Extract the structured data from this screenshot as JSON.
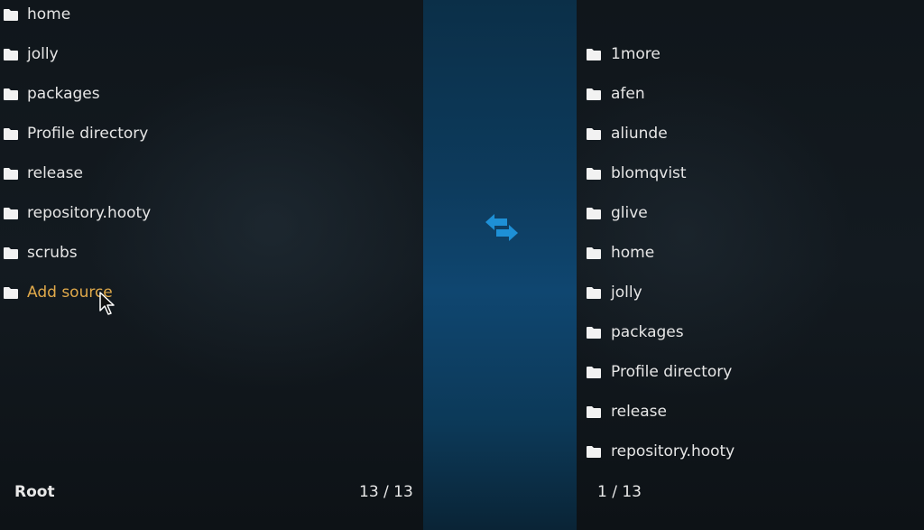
{
  "left_pane": {
    "items": [
      {
        "label": "home",
        "icon": "folder-icon"
      },
      {
        "label": "jolly",
        "icon": "folder-icon"
      },
      {
        "label": "packages",
        "icon": "folder-icon"
      },
      {
        "label": "Profile directory",
        "icon": "folder-icon"
      },
      {
        "label": "release",
        "icon": "folder-icon"
      },
      {
        "label": "repository.hooty",
        "icon": "folder-icon"
      },
      {
        "label": "scrubs",
        "icon": "folder-icon"
      },
      {
        "label": "Add source",
        "icon": "folder-icon",
        "highlight": true
      }
    ],
    "footer_label": "Root",
    "count": "13 / 13"
  },
  "center": {
    "icon": "swap-arrows-icon"
  },
  "right_pane": {
    "items": [
      {
        "label": "1more",
        "icon": "folder-icon"
      },
      {
        "label": "afen",
        "icon": "folder-icon"
      },
      {
        "label": "aliunde",
        "icon": "folder-icon"
      },
      {
        "label": "blomqvist",
        "icon": "folder-icon"
      },
      {
        "label": "glive",
        "icon": "folder-icon"
      },
      {
        "label": "home",
        "icon": "folder-icon"
      },
      {
        "label": "jolly",
        "icon": "folder-icon"
      },
      {
        "label": "packages",
        "icon": "folder-icon"
      },
      {
        "label": "Profile directory",
        "icon": "folder-icon"
      },
      {
        "label": "release",
        "icon": "folder-icon"
      },
      {
        "label": "repository.hooty",
        "icon": "folder-icon"
      }
    ],
    "count": "1 / 13"
  },
  "colors": {
    "text": "#e6e6e6",
    "highlight": "#e0a94a",
    "accent": "#1e90d6",
    "center_strip": "#0f4670"
  }
}
